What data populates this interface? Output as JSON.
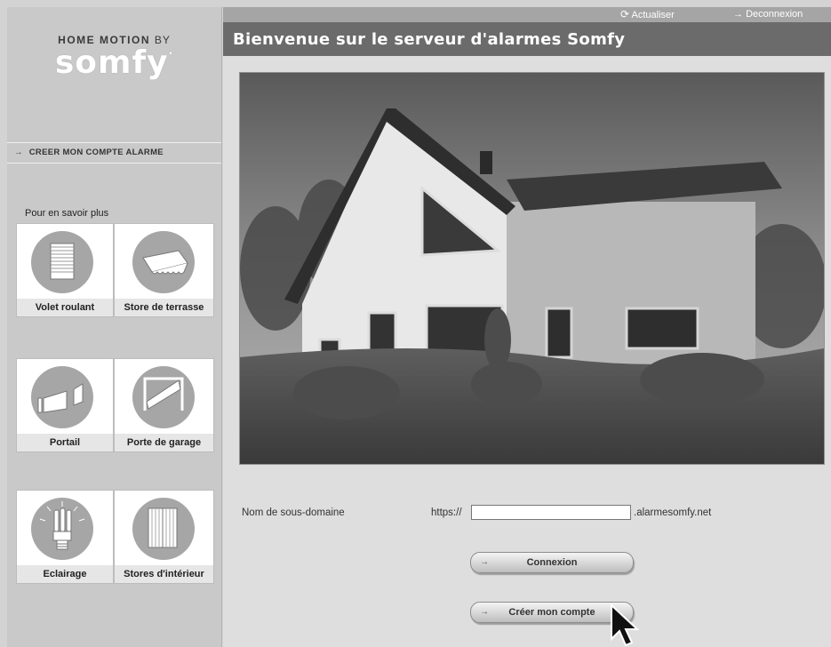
{
  "sidebar": {
    "logo": {
      "tagline": "HOME MOTION",
      "by": "BY",
      "brand": "somfy",
      "registered": "."
    },
    "create_account_link": "CREER MON COMPTE ALARME",
    "learn_more_heading": "Pour en savoir plus",
    "tiles": [
      {
        "label": "Volet roulant",
        "icon": "roller-shutter-icon"
      },
      {
        "label": "Store de terrasse",
        "icon": "awning-icon"
      },
      {
        "label": "Portail",
        "icon": "gate-icon"
      },
      {
        "label": "Porte de garage",
        "icon": "garage-door-icon"
      },
      {
        "label": "Eclairage",
        "icon": "light-bulb-icon"
      },
      {
        "label": "Stores d'intérieur",
        "icon": "indoor-blind-icon"
      }
    ]
  },
  "topbar": {
    "refresh_label": "Actualiser",
    "logout_label": "Deconnexion"
  },
  "title": "Bienvenue sur le serveur d'alarmes Somfy",
  "form": {
    "subdomain_label": "Nom de sous-domaine",
    "prefix": "https://",
    "subdomain_value": "",
    "suffix": ".alarmesomfy.net",
    "login_button": "Connexion",
    "create_button": "Créer mon compte"
  }
}
